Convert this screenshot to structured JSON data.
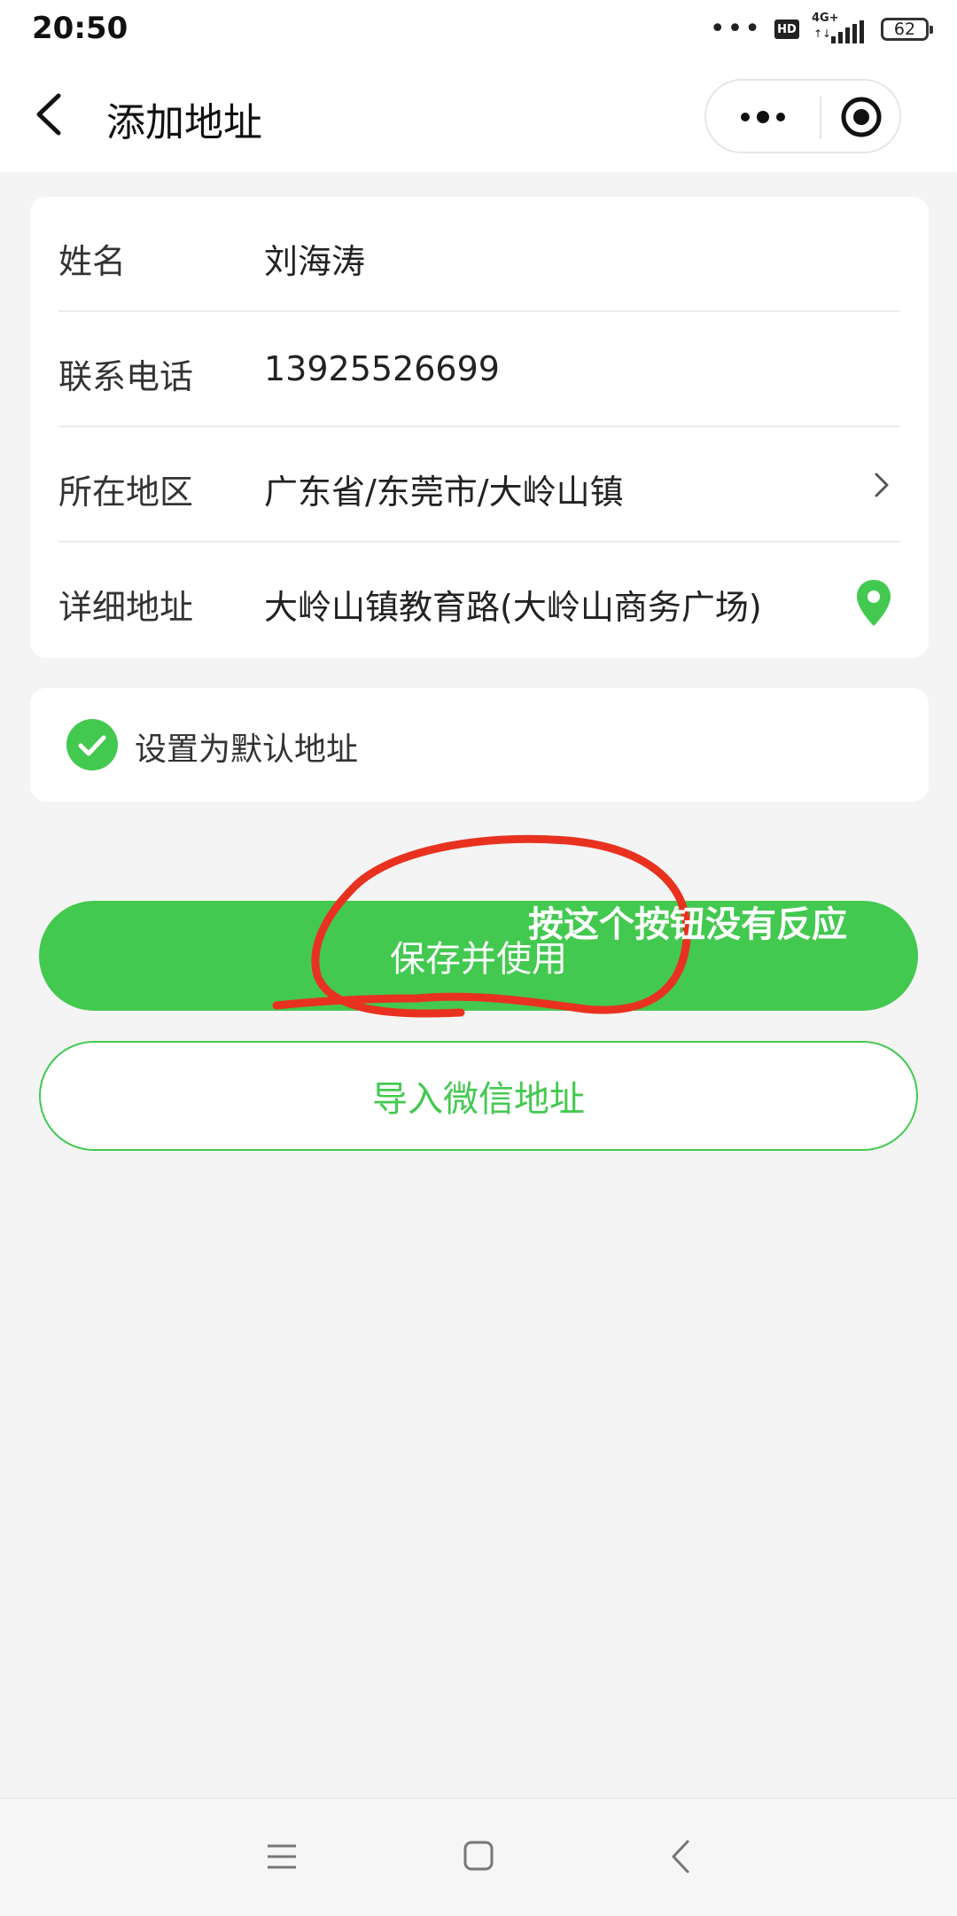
{
  "status_bar": {
    "time": "20:50",
    "dots": "•••",
    "hd": "HD",
    "network": "4G+",
    "network_arrows": "↑↓",
    "battery": "62"
  },
  "nav": {
    "title": "添加地址",
    "back_icon": "chevron-left-icon",
    "more_icon": "more-dots-icon",
    "close_icon": "target-close-icon"
  },
  "form": {
    "rows": [
      {
        "label": "姓名",
        "value": "刘海涛"
      },
      {
        "label": "联系电话",
        "value": "13925526699"
      },
      {
        "label": "所在地区",
        "value": "广东省/东莞市/大岭山镇"
      },
      {
        "label": "详细地址",
        "value": "大岭山镇教育路(大岭山商务广场)"
      }
    ]
  },
  "default_address": {
    "label": "设置为默认地址",
    "checked": true
  },
  "buttons": {
    "save": "保存并使用",
    "import": "导入微信地址"
  },
  "annotation": {
    "text": "按这个按钮没有反应"
  },
  "colors": {
    "accent": "#43c950",
    "annotation_red": "#e8321f",
    "page_bg": "#f4f4f4"
  }
}
